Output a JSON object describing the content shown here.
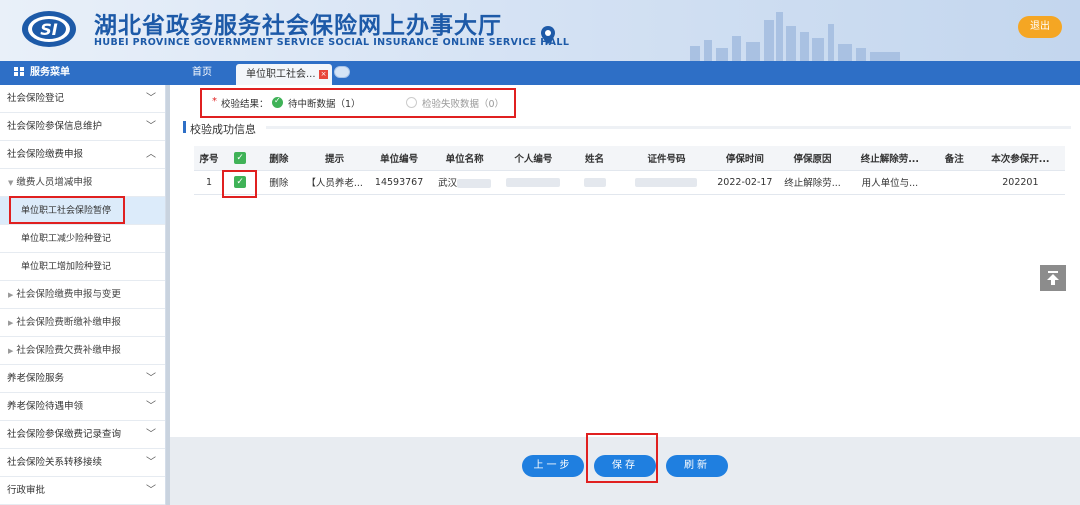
{
  "header": {
    "title": "湖北省政务服务社会保险网上办事大厅",
    "subtitle": "HUBEI PROVINCE GOVERNMENT SERVICE SOCIAL INSURANCE ONLINE SERVICE HALL",
    "logo_text": "SI",
    "logout_label": "退出"
  },
  "menubar": {
    "title": "服务菜单"
  },
  "tabs": {
    "home": "首页",
    "active": "单位职工社会...",
    "close": "×"
  },
  "sidebar": {
    "items": [
      {
        "label": "社会保险登记",
        "chevron": "﹀"
      },
      {
        "label": "社会保险参保信息维护",
        "chevron": "﹀"
      },
      {
        "label": "社会保险缴费申报",
        "chevron": "︿"
      },
      {
        "label": "缴费人员增减申报",
        "marker": "▼"
      },
      {
        "label": "单位职工社会保险暂停"
      },
      {
        "label": "单位职工减少险种登记"
      },
      {
        "label": "单位职工增加险种登记"
      },
      {
        "label": "社会保险缴费申报与变更",
        "marker": "▶"
      },
      {
        "label": "社会保险费断缴补缴申报",
        "marker": "▶"
      },
      {
        "label": "社会保险费欠费补缴申报",
        "marker": "▶"
      },
      {
        "label": "养老保险服务",
        "chevron": "﹀"
      },
      {
        "label": "养老保险待遇申领",
        "chevron": "﹀"
      },
      {
        "label": "社会保险参保缴费记录查询",
        "chevron": "﹀"
      },
      {
        "label": "社会保险关系转移接续",
        "chevron": "﹀"
      },
      {
        "label": "行政审批",
        "chevron": "﹀"
      }
    ]
  },
  "result": {
    "star": "*",
    "label": "校验结果：",
    "option_ok": "待中断数据（1）",
    "option_fail": "检验失败数据（0）"
  },
  "section": {
    "title": "校验成功信息"
  },
  "table": {
    "headers": [
      "序号",
      "",
      "删除",
      "提示",
      "单位编号",
      "单位名称",
      "个人编号",
      "姓名",
      "证件号码",
      "停保时间",
      "停保原因",
      "终止解除劳...",
      "备注",
      "本次参保开..."
    ],
    "rows": [
      {
        "index": "1",
        "delete": "删除",
        "hint": "【人员养老...",
        "unit_no": "14593767",
        "unit_name": "武汉",
        "person_no": "",
        "name": "",
        "id_no": "",
        "stop_date": "2022-02-17",
        "stop_reason": "终止解除劳...",
        "terminate": "用人单位与...",
        "remark": "",
        "start": "202201"
      }
    ]
  },
  "footer": {
    "prev_label": "上一步",
    "save_label": "保存",
    "refresh_label": "刷新"
  },
  "colors": {
    "brand_blue": "#2e6fc6",
    "button_blue": "#1f7fe0",
    "logout_orange": "#f5a623",
    "check_green": "#3fb257",
    "highlight_red": "#e02020"
  }
}
